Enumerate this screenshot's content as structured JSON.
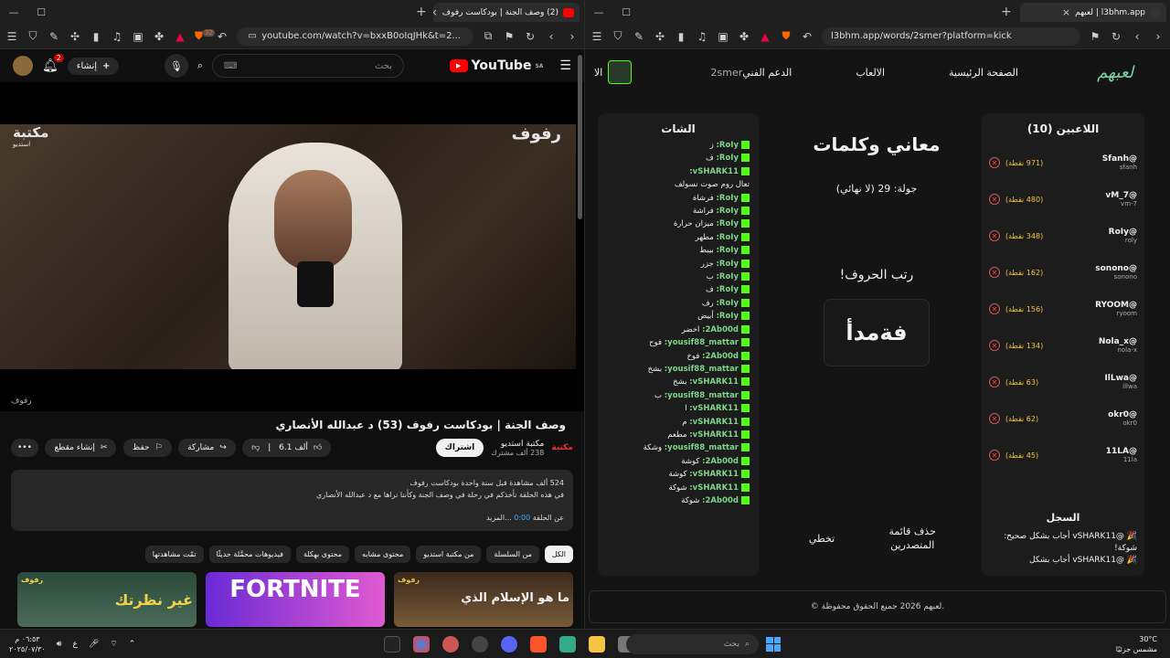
{
  "left_window": {
    "tab_title": "(2) وصف الجنة | بودكاست رفوف",
    "url": "youtube.com/watch?v=bxxB0oIqJHk&t=2...",
    "brave_badge": "32",
    "youtube": {
      "logo": "YouTube",
      "logo_suffix": "SA",
      "search_placeholder": "بحث",
      "create_label": "إنشاء",
      "notifications_count": "2",
      "player_watermark_right": "رفوف",
      "player_watermark_left": "مكتبة",
      "player_watermark_left_sub": "استديو",
      "player_bottom_text": "رفوف",
      "video_title": "وصف الجنة | بودكاست رفوف (53) د عبدالله الأنصاري",
      "channel_name": "مكتبة استديو",
      "channel_subs": "238 ألف مشترك",
      "channel_logo": "مكتبة",
      "subscribe_label": "اشتراك",
      "like_count": "6.1 ألف",
      "share_label": "مشاركة",
      "save_label": "حفظ",
      "clip_label": "إنشاء مقطع",
      "description_line1": "524 ألف مشاهدة  قبل سنة واحدة  بودكاست رفوف",
      "description_line2": "في هذه الحلقة نأخذكم في رحلة في وصف الجنة وكأننا نراها مع د عبدالله الأنصاري",
      "description_line3": "عن الحلقة",
      "description_time": "0:00",
      "description_more": "...المزيد",
      "chips": [
        "الكل",
        "من السلسلة",
        "من مكتبة استديو",
        "محتوى مشابه",
        "محتوى بهكلة",
        "فيديوهات محمَّلة حديثًا",
        "تمّت مشاهدتها"
      ],
      "thumbnails": [
        {
          "text": "ما هو الإسلام الذي",
          "badge": "رفوف"
        },
        {
          "text": "FORTNITE",
          "badge": ""
        },
        {
          "text": "غير نظرتك",
          "badge": "رفوف"
        }
      ]
    }
  },
  "right_window": {
    "tab_title": "l3bhm.app | لعبهم",
    "url": "l3bhm.app/words/2smer?platform=kick",
    "site": {
      "brand": "لعبهم",
      "nav": [
        "الصفحة الرئيسية",
        "الالعاب",
        "الدعم الفني"
      ],
      "nav_user": "2smer",
      "nav_cut": "الا",
      "players_title": "اللاعبين (10)",
      "players": [
        {
          "name": "@Sfanh",
          "user": "sfanh",
          "points": "(971 نقطة)"
        },
        {
          "name": "@vM_7",
          "user": "vm-7",
          "points": "(480 نقطة)"
        },
        {
          "name": "@RoIy",
          "user": "roly",
          "points": "(348 نقطة)"
        },
        {
          "name": "@sonono",
          "user": "sonono",
          "points": "(162 نقطة)"
        },
        {
          "name": "@RYOOM",
          "user": "ryoom",
          "points": "(156 نقطة)"
        },
        {
          "name": "@Nola_x",
          "user": "nola-x",
          "points": "(134 نقطة)"
        },
        {
          "name": "@IlLwa",
          "user": "illwa",
          "points": "(63 نقطة)"
        },
        {
          "name": "@okr0",
          "user": "okr0",
          "points": "(62 نقطة)"
        },
        {
          "name": "@11LA",
          "user": "11la",
          "points": "(45 نقطة)"
        }
      ],
      "log_title": "السجل",
      "log": [
        "🎉 @vSHARK11 أجاب بشكل صحيح: شوكة!",
        "🎉 @vSHARK11 أجاب بشكل"
      ],
      "game_title": "معاني وكلمات",
      "round": "جولة: 29 (لا نهائي)",
      "prompt": "رتب الحروف!",
      "letters": "فةمدأ",
      "btn_clear": "حذف قائمة المتصدرين",
      "btn_skip": "تخطي",
      "chat_title": "الشات",
      "chat": [
        {
          "user": "RoIy:",
          "msg": "ز"
        },
        {
          "user": "RoIy:",
          "msg": "ف"
        },
        {
          "user": "vSHARK11:",
          "msg": ""
        },
        {
          "user": "",
          "msg": "تعال روم صوت نسولف"
        },
        {
          "user": "RoIy:",
          "msg": "فرشاة"
        },
        {
          "user": "RoIy:",
          "msg": "فراشة"
        },
        {
          "user": "RoIy:",
          "msg": "ميزان حرارة"
        },
        {
          "user": "RoIy:",
          "msg": "مطهر"
        },
        {
          "user": "RoIy:",
          "msg": "بيبط"
        },
        {
          "user": "RoIy:",
          "msg": "جزر"
        },
        {
          "user": "RoIy:",
          "msg": "ب"
        },
        {
          "user": "RoIy:",
          "msg": "ف"
        },
        {
          "user": "RoIy:",
          "msg": "رف"
        },
        {
          "user": "RoIy:",
          "msg": "أبيض"
        },
        {
          "user": "2Ab00d:",
          "msg": "اخضر"
        },
        {
          "user": "yousif88_mattar:",
          "msg": "فوح"
        },
        {
          "user": "2Ab00d:",
          "msg": "فوخ"
        },
        {
          "user": "yousif88_mattar:",
          "msg": "بشخ"
        },
        {
          "user": "vSHARK11:",
          "msg": "بشخ"
        },
        {
          "user": "yousif88_mattar:",
          "msg": "ب"
        },
        {
          "user": "vSHARK11:",
          "msg": "ا"
        },
        {
          "user": "vSHARK11:",
          "msg": "م"
        },
        {
          "user": "vSHARK11:",
          "msg": "مطعم"
        },
        {
          "user": "yousif88_mattar:",
          "msg": "وشكة"
        },
        {
          "user": "2Ab00d:",
          "msg": "كوشة"
        },
        {
          "user": "vSHARK11:",
          "msg": "كوشة"
        },
        {
          "user": "vSHARK11:",
          "msg": "شوكة"
        },
        {
          "user": "2Ab00d:",
          "msg": "شوكة"
        }
      ],
      "footer": "© لعبهم 2026 جميع الحقوق محفوظة."
    }
  },
  "taskbar": {
    "time": "٠٦:٥٣ م",
    "date": "٢٠٢٥/٠٧/٣٠",
    "lang": "ع",
    "search_label": "بحث",
    "weather_temp": "30°C",
    "weather_desc": "مشمس جزئيًا"
  }
}
